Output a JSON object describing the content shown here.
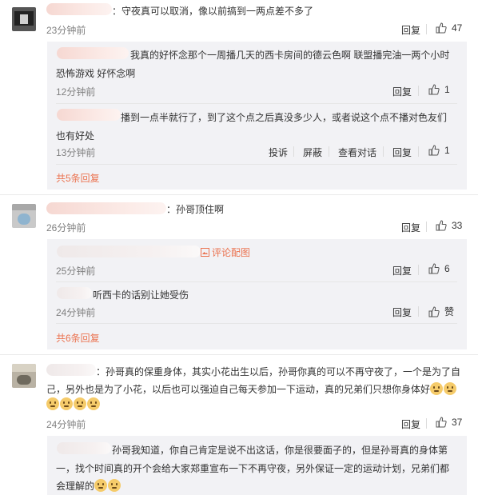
{
  "comments": [
    {
      "text": "：守夜真可以取消，像以前搞到一两点差不多了",
      "time": "23分钟前",
      "reply": "回复",
      "likes": "47"
    },
    {
      "text": "：孙哥顶住啊",
      "time": "26分钟前",
      "reply": "回复",
      "likes": "33"
    },
    {
      "text_line1": "：孙哥真的保重身体，其实小花出生以后，孙哥你真的可以不再守夜了，一个是为了自",
      "text_line2": "己，另外也是为了小花，以后也可以强迫自己每天参加一下运动，真的兄弟们只想你身体好",
      "time": "24分钟前",
      "reply": "回复",
      "likes": "37"
    }
  ],
  "replies": [
    {
      "line1": "我真的好怀念那个一周播几天的西卡房间的德云色啊 联盟播完油一两个小时",
      "line2": "恐怖游戏 好怀念啊",
      "time": "12分钟前",
      "reply": "回复",
      "likes": "1"
    },
    {
      "line1": "播到一点半就行了，到了这个点之后真没多少人，或者说这个点不播对色友们",
      "line2": "也有好处",
      "time": "13分钟前",
      "actions": [
        "投诉",
        "屏蔽",
        "查看对话",
        "回复"
      ],
      "likes": "1"
    },
    {
      "badge": "评论配图",
      "time": "25分钟前",
      "reply": "回复",
      "likes": "6"
    },
    {
      "line1": "听西卡的话别让她受伤",
      "time": "24分钟前",
      "reply": "回复",
      "likes": "赞"
    },
    {
      "line1": "孙哥我知道，你自己肯定是说不出这话，你是很要面子的，但是孙哥真的身体第",
      "line2": "一，找个时间真的开个会给大家郑重宣布一下不再守夜，另外保证一定的运动计划，兄弟们都",
      "line3": "会理解的"
    }
  ],
  "more_links": [
    "共5条回复",
    "共6条回复"
  ],
  "colors": {
    "accent": "#eb7350",
    "time": "#808080",
    "reply_bg": "#f2f2f5"
  }
}
